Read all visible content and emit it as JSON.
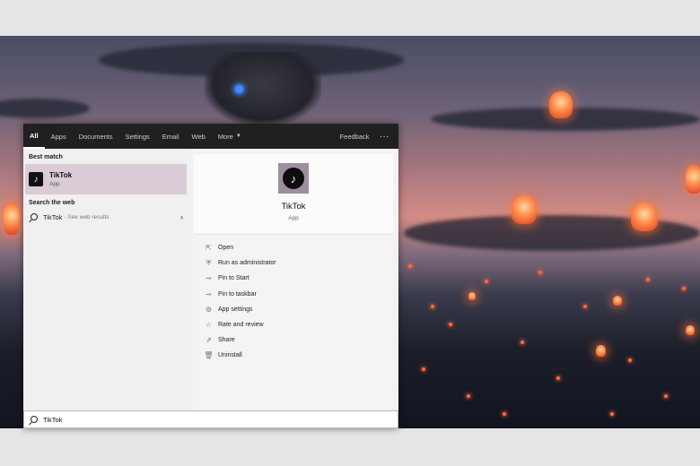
{
  "tabs": [
    {
      "label": "All",
      "active": true
    },
    {
      "label": "Apps"
    },
    {
      "label": "Documents"
    },
    {
      "label": "Settings"
    },
    {
      "label": "Email"
    },
    {
      "label": "Web"
    }
  ],
  "more_label": "More",
  "feedback_label": "Feedback",
  "overflow_label": "···",
  "best_match": {
    "heading": "Best match",
    "name": "TikTok",
    "type": "App"
  },
  "search_web": {
    "heading": "Search the web",
    "query": "TikTok",
    "suffix": "- See web results"
  },
  "preview": {
    "name": "TikTok",
    "type": "App"
  },
  "actions": [
    {
      "label": "Open",
      "icon": "open-icon"
    },
    {
      "label": "Run as administrator",
      "icon": "shield-icon"
    },
    {
      "label": "Pin to Start",
      "icon": "pin-icon"
    },
    {
      "label": "Pin to taskbar",
      "icon": "pin-icon"
    },
    {
      "label": "App settings",
      "icon": "gear-icon"
    },
    {
      "label": "Rate and review",
      "icon": "star-icon"
    },
    {
      "label": "Share",
      "icon": "share-icon"
    },
    {
      "label": "Uninstall",
      "icon": "trash-icon"
    }
  ],
  "search": {
    "value": "TikTok"
  }
}
